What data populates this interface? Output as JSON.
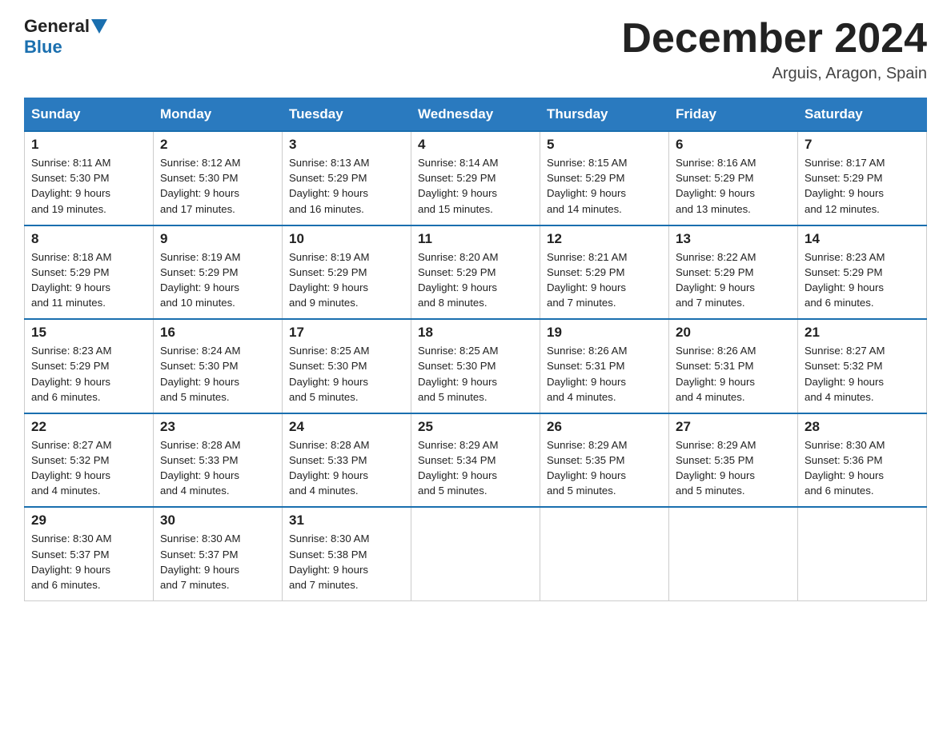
{
  "header": {
    "logo": {
      "general": "General",
      "blue": "Blue"
    },
    "title": "December 2024",
    "location": "Arguis, Aragon, Spain"
  },
  "days_of_week": [
    "Sunday",
    "Monday",
    "Tuesday",
    "Wednesday",
    "Thursday",
    "Friday",
    "Saturday"
  ],
  "weeks": [
    [
      {
        "day": "1",
        "sunrise": "8:11 AM",
        "sunset": "5:30 PM",
        "daylight": "9 hours and 19 minutes."
      },
      {
        "day": "2",
        "sunrise": "8:12 AM",
        "sunset": "5:30 PM",
        "daylight": "9 hours and 17 minutes."
      },
      {
        "day": "3",
        "sunrise": "8:13 AM",
        "sunset": "5:29 PM",
        "daylight": "9 hours and 16 minutes."
      },
      {
        "day": "4",
        "sunrise": "8:14 AM",
        "sunset": "5:29 PM",
        "daylight": "9 hours and 15 minutes."
      },
      {
        "day": "5",
        "sunrise": "8:15 AM",
        "sunset": "5:29 PM",
        "daylight": "9 hours and 14 minutes."
      },
      {
        "day": "6",
        "sunrise": "8:16 AM",
        "sunset": "5:29 PM",
        "daylight": "9 hours and 13 minutes."
      },
      {
        "day": "7",
        "sunrise": "8:17 AM",
        "sunset": "5:29 PM",
        "daylight": "9 hours and 12 minutes."
      }
    ],
    [
      {
        "day": "8",
        "sunrise": "8:18 AM",
        "sunset": "5:29 PM",
        "daylight": "9 hours and 11 minutes."
      },
      {
        "day": "9",
        "sunrise": "8:19 AM",
        "sunset": "5:29 PM",
        "daylight": "9 hours and 10 minutes."
      },
      {
        "day": "10",
        "sunrise": "8:19 AM",
        "sunset": "5:29 PM",
        "daylight": "9 hours and 9 minutes."
      },
      {
        "day": "11",
        "sunrise": "8:20 AM",
        "sunset": "5:29 PM",
        "daylight": "9 hours and 8 minutes."
      },
      {
        "day": "12",
        "sunrise": "8:21 AM",
        "sunset": "5:29 PM",
        "daylight": "9 hours and 7 minutes."
      },
      {
        "day": "13",
        "sunrise": "8:22 AM",
        "sunset": "5:29 PM",
        "daylight": "9 hours and 7 minutes."
      },
      {
        "day": "14",
        "sunrise": "8:23 AM",
        "sunset": "5:29 PM",
        "daylight": "9 hours and 6 minutes."
      }
    ],
    [
      {
        "day": "15",
        "sunrise": "8:23 AM",
        "sunset": "5:29 PM",
        "daylight": "9 hours and 6 minutes."
      },
      {
        "day": "16",
        "sunrise": "8:24 AM",
        "sunset": "5:30 PM",
        "daylight": "9 hours and 5 minutes."
      },
      {
        "day": "17",
        "sunrise": "8:25 AM",
        "sunset": "5:30 PM",
        "daylight": "9 hours and 5 minutes."
      },
      {
        "day": "18",
        "sunrise": "8:25 AM",
        "sunset": "5:30 PM",
        "daylight": "9 hours and 5 minutes."
      },
      {
        "day": "19",
        "sunrise": "8:26 AM",
        "sunset": "5:31 PM",
        "daylight": "9 hours and 4 minutes."
      },
      {
        "day": "20",
        "sunrise": "8:26 AM",
        "sunset": "5:31 PM",
        "daylight": "9 hours and 4 minutes."
      },
      {
        "day": "21",
        "sunrise": "8:27 AM",
        "sunset": "5:32 PM",
        "daylight": "9 hours and 4 minutes."
      }
    ],
    [
      {
        "day": "22",
        "sunrise": "8:27 AM",
        "sunset": "5:32 PM",
        "daylight": "9 hours and 4 minutes."
      },
      {
        "day": "23",
        "sunrise": "8:28 AM",
        "sunset": "5:33 PM",
        "daylight": "9 hours and 4 minutes."
      },
      {
        "day": "24",
        "sunrise": "8:28 AM",
        "sunset": "5:33 PM",
        "daylight": "9 hours and 4 minutes."
      },
      {
        "day": "25",
        "sunrise": "8:29 AM",
        "sunset": "5:34 PM",
        "daylight": "9 hours and 5 minutes."
      },
      {
        "day": "26",
        "sunrise": "8:29 AM",
        "sunset": "5:35 PM",
        "daylight": "9 hours and 5 minutes."
      },
      {
        "day": "27",
        "sunrise": "8:29 AM",
        "sunset": "5:35 PM",
        "daylight": "9 hours and 5 minutes."
      },
      {
        "day": "28",
        "sunrise": "8:30 AM",
        "sunset": "5:36 PM",
        "daylight": "9 hours and 6 minutes."
      }
    ],
    [
      {
        "day": "29",
        "sunrise": "8:30 AM",
        "sunset": "5:37 PM",
        "daylight": "9 hours and 6 minutes."
      },
      {
        "day": "30",
        "sunrise": "8:30 AM",
        "sunset": "5:37 PM",
        "daylight": "9 hours and 7 minutes."
      },
      {
        "day": "31",
        "sunrise": "8:30 AM",
        "sunset": "5:38 PM",
        "daylight": "9 hours and 7 minutes."
      },
      null,
      null,
      null,
      null
    ]
  ]
}
